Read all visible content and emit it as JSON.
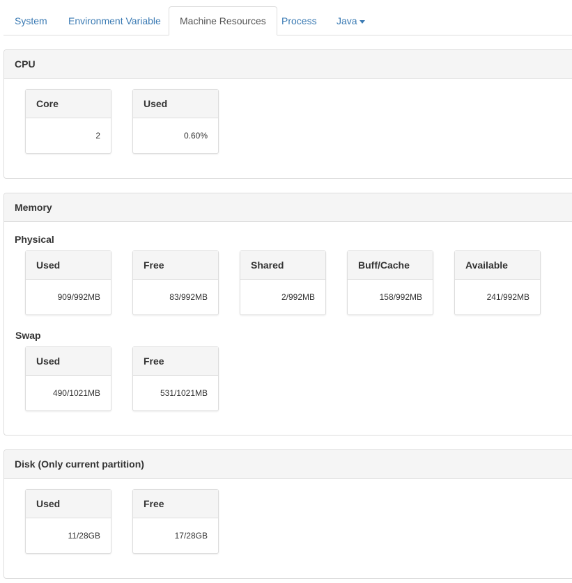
{
  "tabs": [
    {
      "label": "System"
    },
    {
      "label": "Environment Variable"
    },
    {
      "label": "Machine Resources"
    },
    {
      "label": "Process"
    },
    {
      "label": "Java"
    }
  ],
  "active_tab": "Machine Resources",
  "cpu": {
    "title": "CPU",
    "core": {
      "label": "Core",
      "value": "2"
    },
    "used": {
      "label": "Used",
      "value": "0.60%"
    }
  },
  "memory": {
    "title": "Memory",
    "physical": {
      "label": "Physical",
      "used": {
        "label": "Used",
        "value": "909/992MB"
      },
      "free": {
        "label": "Free",
        "value": "83/992MB"
      },
      "shared": {
        "label": "Shared",
        "value": "2/992MB"
      },
      "buff_cache": {
        "label": "Buff/Cache",
        "value": "158/992MB"
      },
      "available": {
        "label": "Available",
        "value": "241/992MB"
      }
    },
    "swap": {
      "label": "Swap",
      "used": {
        "label": "Used",
        "value": "490/1021MB"
      },
      "free": {
        "label": "Free",
        "value": "531/1021MB"
      }
    }
  },
  "disk": {
    "title": "Disk (Only current partition)",
    "used": {
      "label": "Used",
      "value": "11/28GB"
    },
    "free": {
      "label": "Free",
      "value": "17/28GB"
    }
  }
}
